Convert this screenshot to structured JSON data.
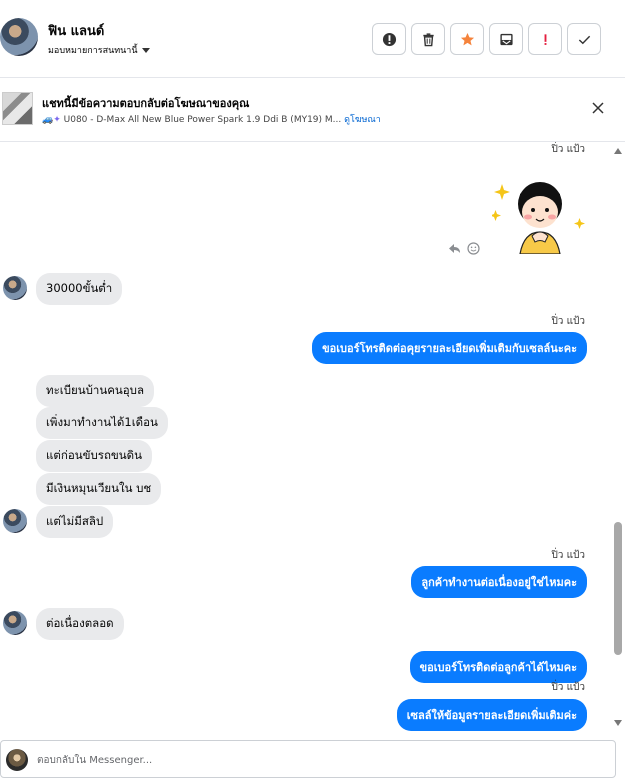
{
  "header": {
    "contact_name": "ฟิน แลนด์",
    "assign_label": "มอบหมายการสนทนานี้",
    "actions": [
      {
        "name": "report-icon",
        "color": "#333333"
      },
      {
        "name": "trash-icon",
        "color": "#333333"
      },
      {
        "name": "star-icon",
        "color": "#f5833c"
      },
      {
        "name": "archive-icon",
        "color": "#333333"
      },
      {
        "name": "exclamation-icon",
        "color": "#e41e3f"
      },
      {
        "name": "check-icon",
        "color": "#333333"
      }
    ]
  },
  "ad_banner": {
    "title": "แชทนี้มีข้อความตอบกลับต่อโฆษณาของคุณ",
    "subtitle": "U080 - D-Max All New Blue Power Spark 1.9 Ddi B (MY19) M...",
    "link_label": "ดูโฆษณา"
  },
  "messages": {
    "sender_1": "ปิ่ว แป้ว",
    "in_1": "30000ขั้นต่ำ",
    "sender_2": "ปิ่ว แป้ว",
    "out_1": "ขอเบอร์โทรติดต่อคุยรายละเอียดเพิ่มเติมกับเซลล์นะคะ",
    "in_2": "ทะเบียนบ้านคนอุบล",
    "in_3": "เพิ่งมาทำงานได้1เดือน",
    "in_4": "แต่ก่อนขับรถขนดิน",
    "in_5": "มีเงินหมุนเวียนใน บช",
    "in_6": "แต่ไม่มีสลิป",
    "sender_3": "ปิ่ว แป้ว",
    "out_2": "ลูกค้าทำงานต่อเนื่องอยู่ใช่ไหมคะ",
    "in_7": "ต่อเนื่องตลอด",
    "out_3": "ขอเบอร์โทรติดต่อลูกค้าได้ไหมคะ",
    "sender_4": "ปิ่ว แป้ว",
    "out_4": "เซลล์ให้ข้อมูลรายละเอียดเพิ่มเติมค่ะ"
  },
  "composer": {
    "placeholder": "ตอบกลับใน Messenger..."
  },
  "colors": {
    "outgoing_bubble": "#0a7cff",
    "incoming_bubble": "#e9eaec",
    "link": "#0064d1"
  }
}
